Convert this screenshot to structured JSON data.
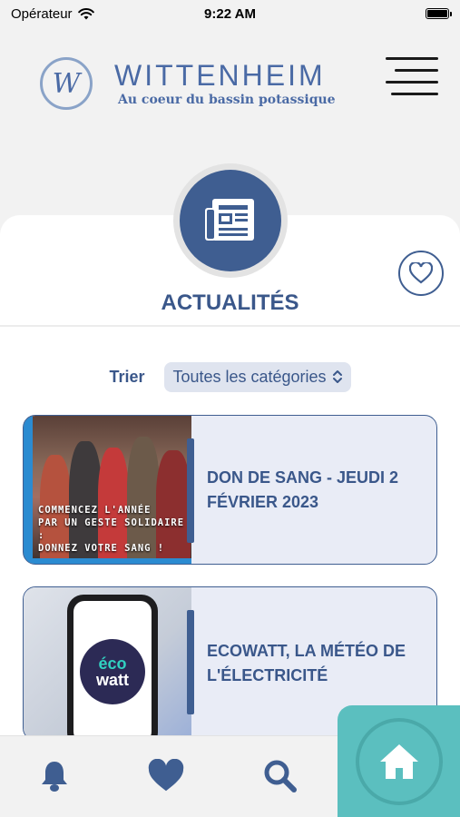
{
  "status_bar": {
    "carrier": "Opérateur",
    "time": "9:22 AM"
  },
  "header": {
    "logo_letter": "W",
    "title": "WITTENHEIM",
    "subtitle": "Au coeur du bassin potassique"
  },
  "section": {
    "title": "ACTUALITÉS"
  },
  "sort": {
    "label": "Trier",
    "selected": "Toutes les catégories"
  },
  "news": [
    {
      "title": "DON DE SANG - JEUDI 2 FÉVRIER 2023",
      "caption_lines": [
        "COMMENCEZ L'ANNÉE",
        "PAR UN GESTE SOLIDAIRE :",
        "DONNEZ VOTRE SANG !"
      ]
    },
    {
      "title": "ECOWATT, LA MÉTÉO DE L'ÉLECTRICITÉ",
      "badge_top": "éco",
      "badge_bottom": "watt"
    }
  ],
  "tabs": [
    "bell-icon",
    "heart-icon",
    "search-icon",
    "home-icon"
  ],
  "colors": {
    "primary": "#3f5e91",
    "teal": "#5bbfbf",
    "card_bg": "#e9ecf6"
  }
}
